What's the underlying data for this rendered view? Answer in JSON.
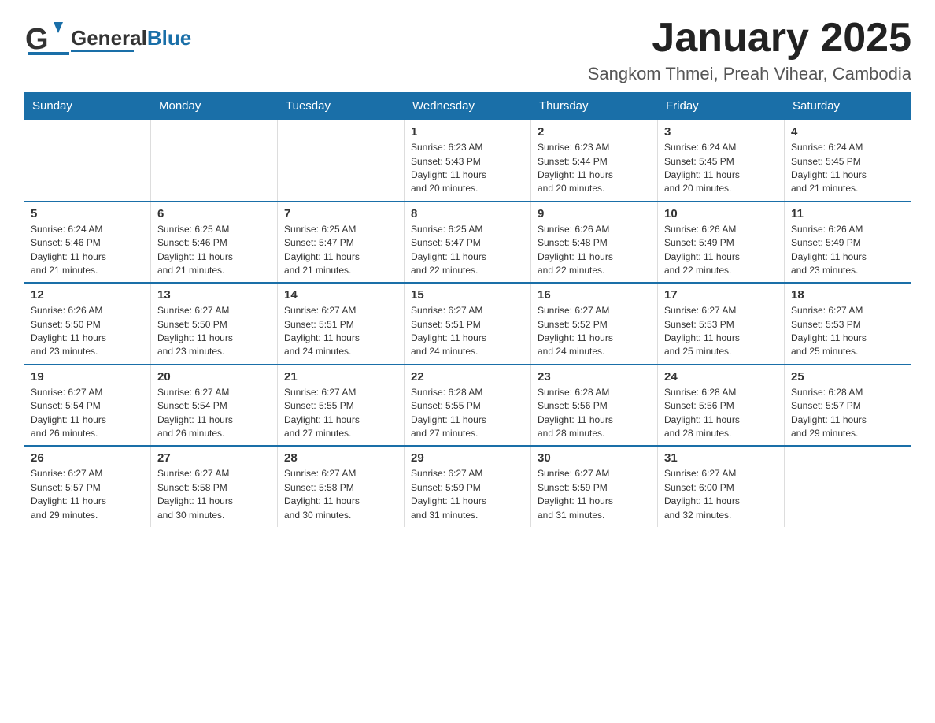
{
  "header": {
    "logo_text_general": "General",
    "logo_text_blue": "Blue",
    "month_year": "January 2025",
    "location": "Sangkom Thmei, Preah Vihear, Cambodia"
  },
  "calendar": {
    "days_of_week": [
      "Sunday",
      "Monday",
      "Tuesday",
      "Wednesday",
      "Thursday",
      "Friday",
      "Saturday"
    ],
    "weeks": [
      [
        {
          "day": "",
          "info": ""
        },
        {
          "day": "",
          "info": ""
        },
        {
          "day": "",
          "info": ""
        },
        {
          "day": "1",
          "info": "Sunrise: 6:23 AM\nSunset: 5:43 PM\nDaylight: 11 hours\nand 20 minutes."
        },
        {
          "day": "2",
          "info": "Sunrise: 6:23 AM\nSunset: 5:44 PM\nDaylight: 11 hours\nand 20 minutes."
        },
        {
          "day": "3",
          "info": "Sunrise: 6:24 AM\nSunset: 5:45 PM\nDaylight: 11 hours\nand 20 minutes."
        },
        {
          "day": "4",
          "info": "Sunrise: 6:24 AM\nSunset: 5:45 PM\nDaylight: 11 hours\nand 21 minutes."
        }
      ],
      [
        {
          "day": "5",
          "info": "Sunrise: 6:24 AM\nSunset: 5:46 PM\nDaylight: 11 hours\nand 21 minutes."
        },
        {
          "day": "6",
          "info": "Sunrise: 6:25 AM\nSunset: 5:46 PM\nDaylight: 11 hours\nand 21 minutes."
        },
        {
          "day": "7",
          "info": "Sunrise: 6:25 AM\nSunset: 5:47 PM\nDaylight: 11 hours\nand 21 minutes."
        },
        {
          "day": "8",
          "info": "Sunrise: 6:25 AM\nSunset: 5:47 PM\nDaylight: 11 hours\nand 22 minutes."
        },
        {
          "day": "9",
          "info": "Sunrise: 6:26 AM\nSunset: 5:48 PM\nDaylight: 11 hours\nand 22 minutes."
        },
        {
          "day": "10",
          "info": "Sunrise: 6:26 AM\nSunset: 5:49 PM\nDaylight: 11 hours\nand 22 minutes."
        },
        {
          "day": "11",
          "info": "Sunrise: 6:26 AM\nSunset: 5:49 PM\nDaylight: 11 hours\nand 23 minutes."
        }
      ],
      [
        {
          "day": "12",
          "info": "Sunrise: 6:26 AM\nSunset: 5:50 PM\nDaylight: 11 hours\nand 23 minutes."
        },
        {
          "day": "13",
          "info": "Sunrise: 6:27 AM\nSunset: 5:50 PM\nDaylight: 11 hours\nand 23 minutes."
        },
        {
          "day": "14",
          "info": "Sunrise: 6:27 AM\nSunset: 5:51 PM\nDaylight: 11 hours\nand 24 minutes."
        },
        {
          "day": "15",
          "info": "Sunrise: 6:27 AM\nSunset: 5:51 PM\nDaylight: 11 hours\nand 24 minutes."
        },
        {
          "day": "16",
          "info": "Sunrise: 6:27 AM\nSunset: 5:52 PM\nDaylight: 11 hours\nand 24 minutes."
        },
        {
          "day": "17",
          "info": "Sunrise: 6:27 AM\nSunset: 5:53 PM\nDaylight: 11 hours\nand 25 minutes."
        },
        {
          "day": "18",
          "info": "Sunrise: 6:27 AM\nSunset: 5:53 PM\nDaylight: 11 hours\nand 25 minutes."
        }
      ],
      [
        {
          "day": "19",
          "info": "Sunrise: 6:27 AM\nSunset: 5:54 PM\nDaylight: 11 hours\nand 26 minutes."
        },
        {
          "day": "20",
          "info": "Sunrise: 6:27 AM\nSunset: 5:54 PM\nDaylight: 11 hours\nand 26 minutes."
        },
        {
          "day": "21",
          "info": "Sunrise: 6:27 AM\nSunset: 5:55 PM\nDaylight: 11 hours\nand 27 minutes."
        },
        {
          "day": "22",
          "info": "Sunrise: 6:28 AM\nSunset: 5:55 PM\nDaylight: 11 hours\nand 27 minutes."
        },
        {
          "day": "23",
          "info": "Sunrise: 6:28 AM\nSunset: 5:56 PM\nDaylight: 11 hours\nand 28 minutes."
        },
        {
          "day": "24",
          "info": "Sunrise: 6:28 AM\nSunset: 5:56 PM\nDaylight: 11 hours\nand 28 minutes."
        },
        {
          "day": "25",
          "info": "Sunrise: 6:28 AM\nSunset: 5:57 PM\nDaylight: 11 hours\nand 29 minutes."
        }
      ],
      [
        {
          "day": "26",
          "info": "Sunrise: 6:27 AM\nSunset: 5:57 PM\nDaylight: 11 hours\nand 29 minutes."
        },
        {
          "day": "27",
          "info": "Sunrise: 6:27 AM\nSunset: 5:58 PM\nDaylight: 11 hours\nand 30 minutes."
        },
        {
          "day": "28",
          "info": "Sunrise: 6:27 AM\nSunset: 5:58 PM\nDaylight: 11 hours\nand 30 minutes."
        },
        {
          "day": "29",
          "info": "Sunrise: 6:27 AM\nSunset: 5:59 PM\nDaylight: 11 hours\nand 31 minutes."
        },
        {
          "day": "30",
          "info": "Sunrise: 6:27 AM\nSunset: 5:59 PM\nDaylight: 11 hours\nand 31 minutes."
        },
        {
          "day": "31",
          "info": "Sunrise: 6:27 AM\nSunset: 6:00 PM\nDaylight: 11 hours\nand 32 minutes."
        },
        {
          "day": "",
          "info": ""
        }
      ]
    ]
  }
}
